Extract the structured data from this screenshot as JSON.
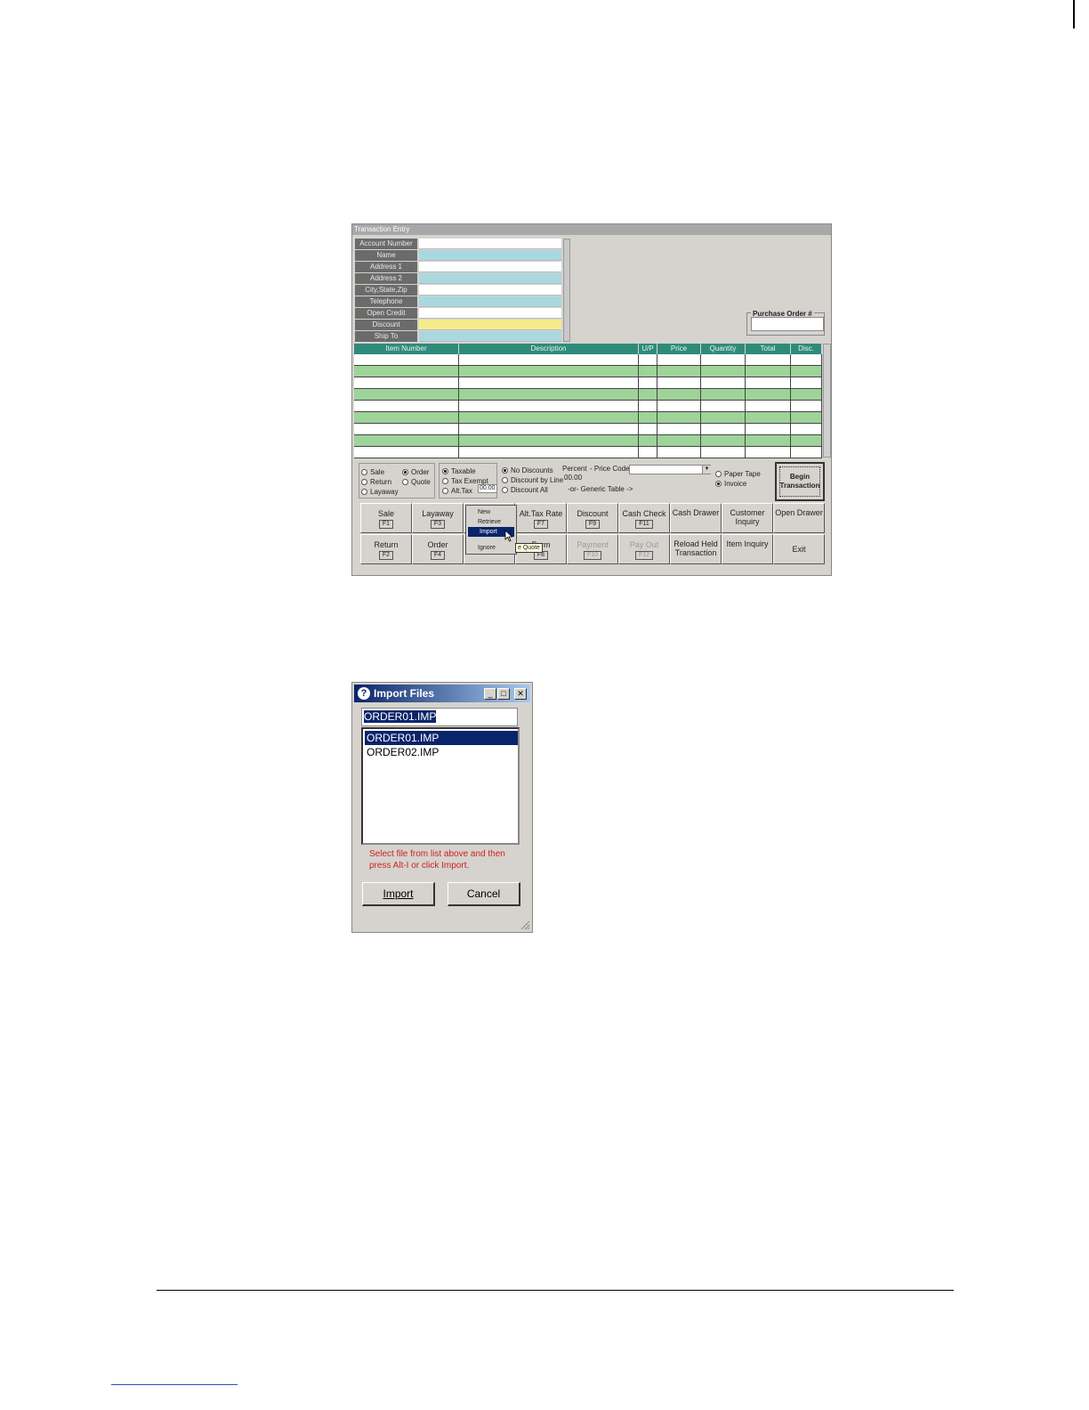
{
  "transaction_window": {
    "title": "Transaction Entry",
    "account_fields": [
      {
        "label": "Account Number",
        "color": "#ffffff"
      },
      {
        "label": "Name",
        "color": "#a9d8e0"
      },
      {
        "label": "Address 1",
        "color": "#ffffff"
      },
      {
        "label": "Address 2",
        "color": "#a9d8e0"
      },
      {
        "label": "City,State,Zip",
        "color": "#ffffff"
      },
      {
        "label": "Telephone",
        "color": "#a9d8e0"
      },
      {
        "label": "Open Credit",
        "color": "#ffffff"
      },
      {
        "label": "Discount",
        "color": "#f4ec8c"
      },
      {
        "label": "Ship To",
        "color": "#a9d8e0"
      }
    ],
    "purchase_order_label": "Purchase Order #",
    "grid_columns": [
      "Item Number",
      "Description",
      "U/P",
      "Price",
      "Quantity",
      "Total",
      "Disc."
    ],
    "row_colors": [
      "#ffffff",
      "#9ed39a"
    ],
    "transaction_types": [
      {
        "label": "Sale",
        "checked": false
      },
      {
        "label": "Order",
        "checked": true
      },
      {
        "label": "Return",
        "checked": false
      },
      {
        "label": "Quote",
        "checked": false
      },
      {
        "label": "Layaway",
        "checked": false
      }
    ],
    "tax_options": [
      {
        "label": "Taxable",
        "checked": true
      },
      {
        "label": "Tax Exempt",
        "checked": false
      },
      {
        "label": "Alt.Tax",
        "checked": false
      }
    ],
    "alt_tax_value": "00.00",
    "discount_options": [
      {
        "label": "No Discounts",
        "checked": true
      },
      {
        "label": "Discount by Line",
        "checked": false
      },
      {
        "label": "Discount All",
        "checked": false
      }
    ],
    "percent_label": "Percent",
    "price_code_label": "- Price Code",
    "percent_value": "00.00",
    "generic_table_label": "-or- Generic Table ->",
    "output_options": [
      {
        "label": "Paper Tape",
        "checked": false
      },
      {
        "label": "Invoice",
        "checked": true
      }
    ],
    "begin_button": "Begin Transaction",
    "buttons_row1": [
      {
        "label": "Sale",
        "key": "F1",
        "enabled": true
      },
      {
        "label": "Layaway",
        "key": "F3",
        "enabled": true
      },
      {
        "label": "",
        "key": "",
        "enabled": true
      },
      {
        "label": "Alt.Tax Rate",
        "key": "F7",
        "enabled": true
      },
      {
        "label": "Discount",
        "key": "F9",
        "enabled": true
      },
      {
        "label": "Cash Check",
        "key": "F11",
        "enabled": true
      },
      {
        "label": "Cash Drawer",
        "key": "",
        "enabled": true
      },
      {
        "label": "Customer Inquiry",
        "key": "",
        "enabled": true
      },
      {
        "label": "Open Drawer",
        "key": "",
        "enabled": true
      }
    ],
    "buttons_row2": [
      {
        "label": "Return",
        "key": "F2",
        "enabled": true
      },
      {
        "label": "Order",
        "key": "F4",
        "enabled": true
      },
      {
        "label": "",
        "key": "F6",
        "enabled": true
      },
      {
        "label": "Form",
        "key": "F8",
        "enabled": true
      },
      {
        "label": "Payment",
        "key": "F10",
        "enabled": false
      },
      {
        "label": "Pay Out",
        "key": "F12",
        "enabled": false
      },
      {
        "label": "Reload Held Transaction",
        "key": "",
        "enabled": true
      },
      {
        "label": "Item Inquiry",
        "key": "",
        "enabled": true
      },
      {
        "label": "Exit",
        "key": "",
        "enabled": true
      }
    ],
    "popup_menu": [
      "New",
      "Retrieve",
      "Import",
      "Ignore"
    ],
    "popup_selected": "Import",
    "tooltip": "e Quote"
  },
  "import_dialog": {
    "title": "Import Files",
    "filename_value": "ORDER01.IMP",
    "files": [
      "ORDER01.IMP",
      "ORDER02.IMP"
    ],
    "selected_file": "ORDER01.IMP",
    "help_text": "Select file from list above and then press Alt-I or click Import.",
    "import_button": "Import",
    "cancel_button": "Cancel",
    "title_buttons": {
      "minimize": "_",
      "maximize": "□",
      "close": "✕"
    }
  }
}
